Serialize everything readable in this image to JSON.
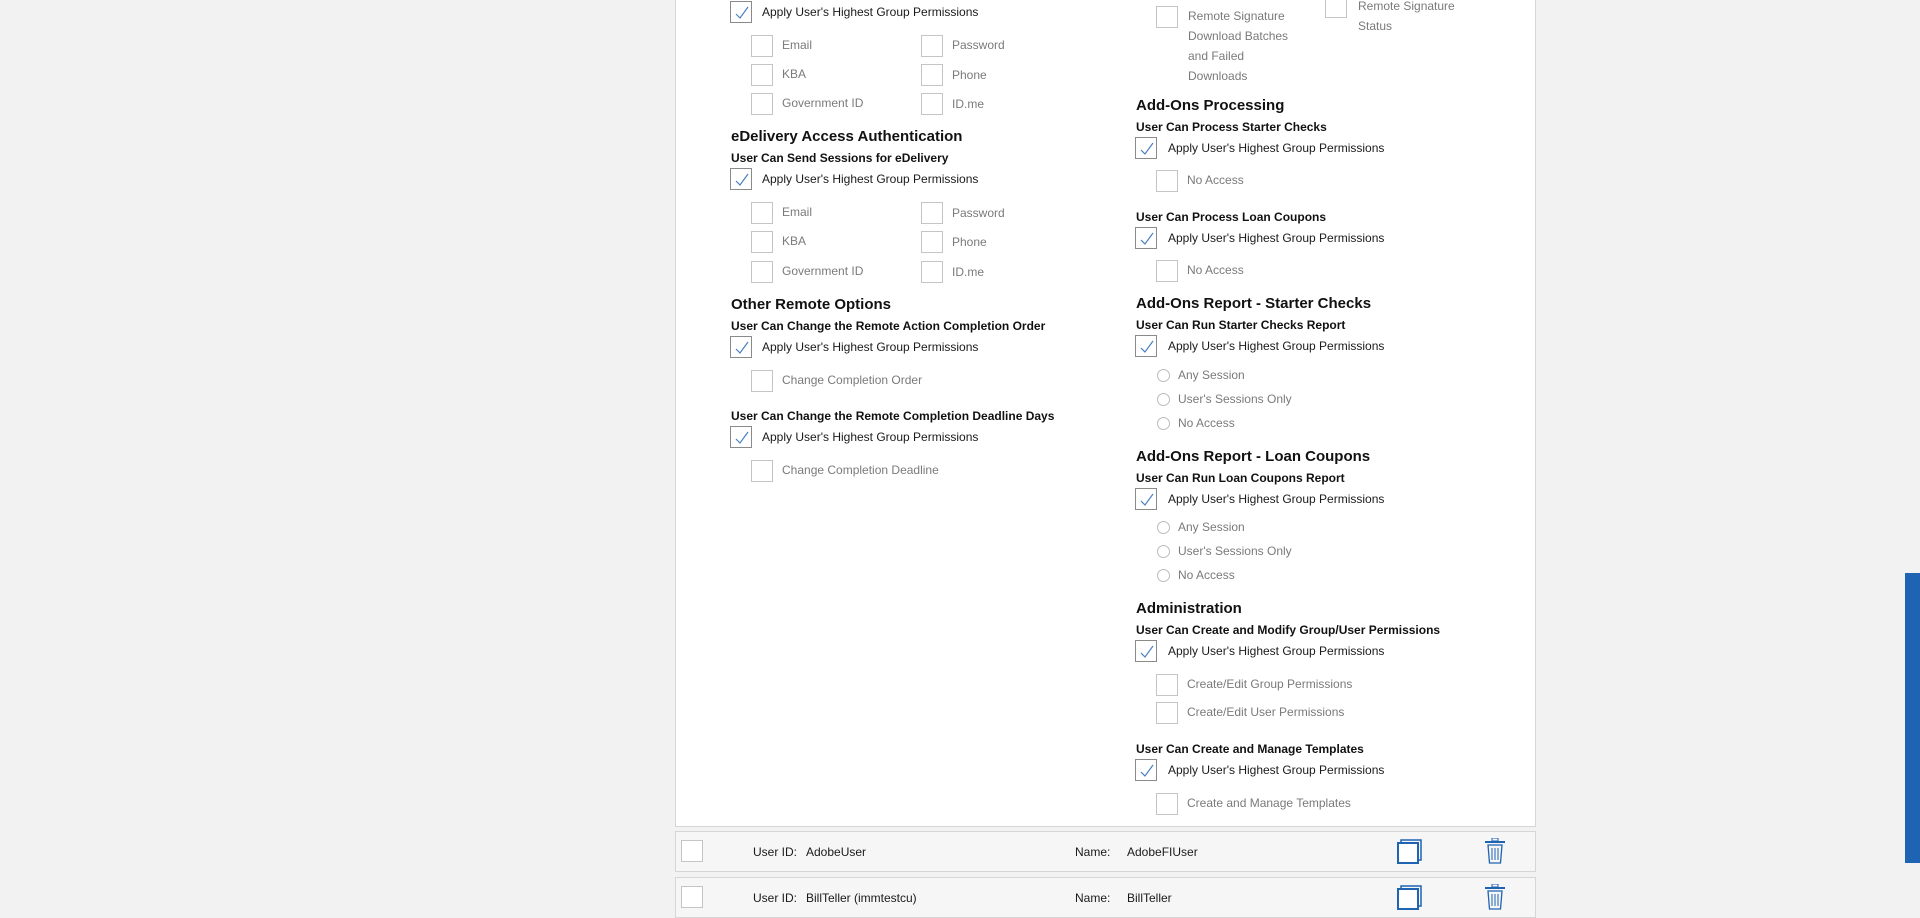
{
  "common": {
    "apply_label": "Apply User's Highest Group Permissions"
  },
  "auth_top": {
    "options": {
      "email": "Email",
      "password": "Password",
      "kba": "KBA",
      "phone": "Phone",
      "government_id": "Government ID",
      "idme": "ID.me"
    }
  },
  "remote_signature": {
    "download_label": "Remote Signature Download Batches and Failed Downloads",
    "status_label": "Remote Signature Status"
  },
  "edelivery": {
    "title": "eDelivery Access Authentication",
    "subtitle": "User Can Send Sessions for eDelivery",
    "options": {
      "email": "Email",
      "password": "Password",
      "kba": "KBA",
      "phone": "Phone",
      "government_id": "Government ID",
      "idme": "ID.me"
    }
  },
  "other_remote": {
    "title": "Other Remote Options",
    "completion_order": {
      "subtitle": "User Can Change the Remote Action Completion Order",
      "option": "Change Completion Order"
    },
    "completion_deadline": {
      "subtitle": "User Can Change the Remote Completion Deadline Days",
      "option": "Change Completion Deadline"
    }
  },
  "addons_processing": {
    "title": "Add-Ons Processing",
    "starter_checks": {
      "subtitle": "User Can Process Starter Checks",
      "option": "No Access"
    },
    "loan_coupons": {
      "subtitle": "User Can Process Loan Coupons",
      "option": "No Access"
    }
  },
  "report_starter": {
    "title": "Add-Ons Report - Starter Checks",
    "subtitle": "User Can Run Starter Checks Report",
    "radios": [
      "Any Session",
      "User's Sessions Only",
      "No Access"
    ]
  },
  "report_loan": {
    "title": "Add-Ons Report - Loan Coupons",
    "subtitle": "User Can Run Loan Coupons Report",
    "radios": [
      "Any Session",
      "User's Sessions Only",
      "No Access"
    ]
  },
  "administration": {
    "title": "Administration",
    "permissions": {
      "subtitle": "User Can Create and Modify Group/User Permissions",
      "options": [
        "Create/Edit Group Permissions",
        "Create/Edit User Permissions"
      ]
    },
    "templates": {
      "subtitle": "User Can Create and Manage Templates",
      "option": "Create and Manage Templates"
    }
  },
  "user_rows": [
    {
      "user_id_label": "User ID:",
      "user_id": "AdobeUser",
      "name_label": "Name:",
      "name": "AdobeFIUser"
    },
    {
      "user_id_label": "User ID:",
      "user_id": "BillTeller (immtestcu)",
      "name_label": "Name:",
      "name": "BillTeller"
    }
  ],
  "colors": {
    "accent": "#1f63b3",
    "check": "#4a7fc1"
  }
}
